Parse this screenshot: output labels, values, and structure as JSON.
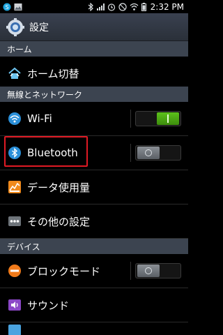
{
  "status_bar": {
    "time": "2:32 PM",
    "left_icons": [
      "skype-icon",
      "image-icon"
    ],
    "right_icons": [
      "bluetooth-icon",
      "signal-icon",
      "alarm-icon",
      "nosync-icon",
      "wifi-icon",
      "battery-icon"
    ]
  },
  "title_bar": {
    "title": "設定",
    "icon": "gear-icon"
  },
  "sections": {
    "home": "ホーム",
    "wireless": "無線とネットワーク",
    "device": "デバイス"
  },
  "items": {
    "home_switch": {
      "label": "ホーム切替",
      "icon": "home-switch-icon"
    },
    "wifi": {
      "label": "Wi-Fi",
      "icon": "wifi-icon",
      "toggle": "on"
    },
    "bluetooth": {
      "label": "Bluetooth",
      "icon": "bluetooth-icon",
      "toggle": "off"
    },
    "data_usage": {
      "label": "データ使用量",
      "icon": "data-usage-icon"
    },
    "other_settings": {
      "label": "その他の設定",
      "icon": "more-icon"
    },
    "block_mode": {
      "label": "ブロックモード",
      "icon": "block-icon",
      "toggle": "off"
    },
    "sound": {
      "label": "サウンド",
      "icon": "sound-icon"
    }
  },
  "colors": {
    "title_bar": "#2a3039",
    "section_header": "#3c4450",
    "toggle_on": "#4ca914",
    "highlight": "#e01a24"
  }
}
